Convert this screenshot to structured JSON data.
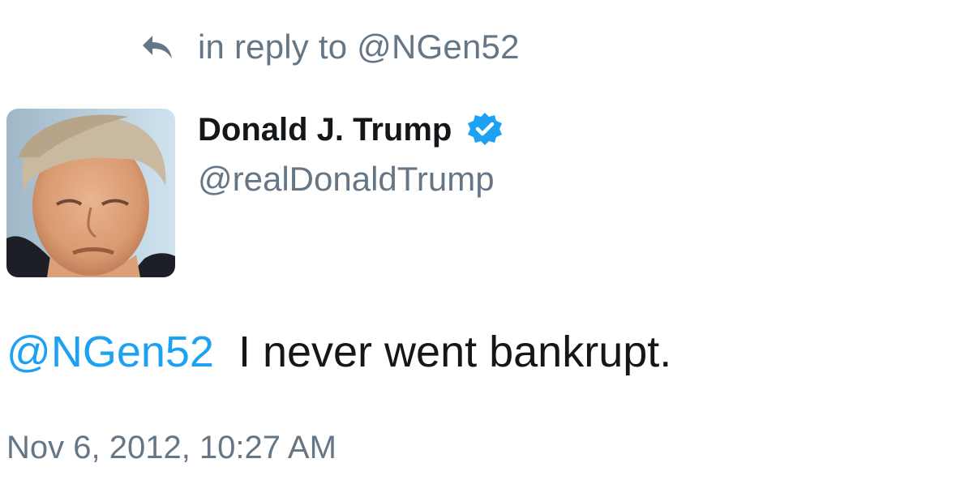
{
  "colors": {
    "link": "#1da1f2",
    "secondary_text": "#657786",
    "primary_text": "#14171a",
    "verified_badge": "#1da1f2"
  },
  "reply_context": {
    "icon": "reply-arrow-icon",
    "text": "in reply to @NGen52"
  },
  "author": {
    "display_name": "Donald J. Trump",
    "verified_icon": "verified-badge-icon",
    "handle": "@realDonaldTrump",
    "avatar": "profile-photo"
  },
  "tweet": {
    "mention": "@NGen52",
    "body": "I never went bankrupt."
  },
  "timestamp": "Nov 6, 2012, 10:27 AM"
}
